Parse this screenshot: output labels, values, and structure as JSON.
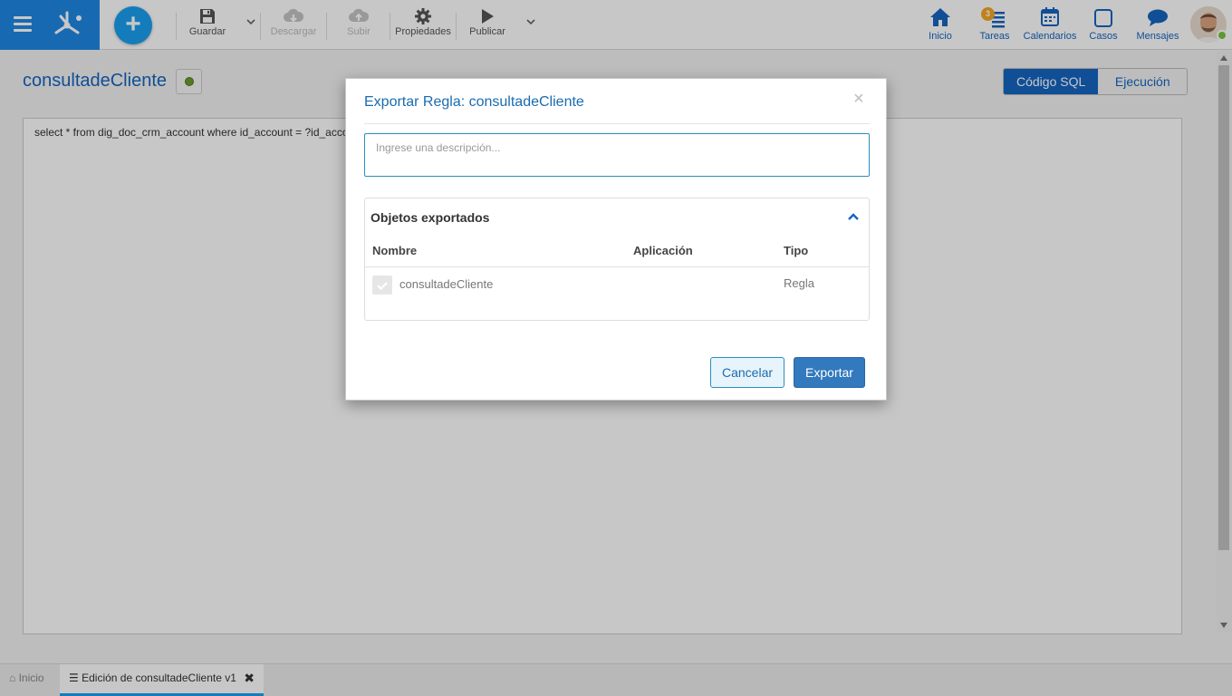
{
  "toolbar": {
    "save_label": "Guardar",
    "download_label": "Descargar",
    "upload_label": "Subir",
    "properties_label": "Propiedades",
    "publish_label": "Publicar"
  },
  "nav": {
    "home_label": "Inicio",
    "tasks_label": "Tareas",
    "tasks_badge": "3",
    "calendars_label": "Calendarios",
    "cases_label": "Casos",
    "messages_label": "Mensajes"
  },
  "page": {
    "title": "consultadeCliente",
    "sql_text": "select * from dig_doc_crm_account where id_account = ?id_account",
    "tab_sql": "Código SQL",
    "tab_exec": "Ejecución"
  },
  "modal": {
    "title": "Exportar Regla: consultadeCliente",
    "close": "×",
    "description_placeholder": "Ingrese una descripción...",
    "panel_title": "Objetos exportados",
    "columns": [
      "Nombre",
      "Aplicación",
      "Tipo"
    ],
    "rows": [
      {
        "name": "consultadeCliente",
        "app": "",
        "type": "Regla"
      }
    ],
    "cancel_label": "Cancelar",
    "export_label": "Exportar"
  },
  "bottom_tabs": {
    "home_label": "Inicio",
    "active_label": "Edición de consultadeCliente v1",
    "close": "✖"
  },
  "colors": {
    "brand": "#1e88e5",
    "accent": "#1a9ff0",
    "primary_button": "#3279bd",
    "online": "#7cc242",
    "badge": "#f5a623"
  },
  "icons": {
    "menu": "hamburger-icon",
    "logo": "app-logo-icon",
    "add": "plus-icon",
    "save": "floppy-icon",
    "download": "cloud-download-icon",
    "upload": "cloud-upload-icon",
    "properties": "gear-icon",
    "publish": "play-icon",
    "home": "house-icon",
    "tasks": "tasks-icon",
    "calendars": "calendar-icon",
    "cases": "square-icon",
    "messages": "chat-bubble-icon"
  }
}
